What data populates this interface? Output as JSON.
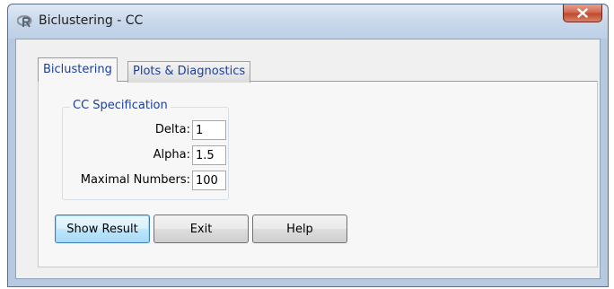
{
  "window": {
    "title": "Biclustering - CC",
    "app_icon": "r-logo-icon",
    "close_icon": "close-icon"
  },
  "tabs": [
    {
      "label": "Biclustering",
      "active": true
    },
    {
      "label": "Plots & Diagnostics",
      "active": false
    }
  ],
  "specification": {
    "title": "CC Specification",
    "fields": [
      {
        "label": "Delta:",
        "value": "1"
      },
      {
        "label": "Alpha:",
        "value": "1.5"
      },
      {
        "label": "Maximal Numbers:",
        "value": "100"
      }
    ]
  },
  "buttons": {
    "show_result": "Show Result",
    "exit": "Exit",
    "help": "Help"
  },
  "colors": {
    "tab_text": "#1a3fa0",
    "titlebar": "#c9d8ea",
    "close_button": "#c14a2e"
  }
}
